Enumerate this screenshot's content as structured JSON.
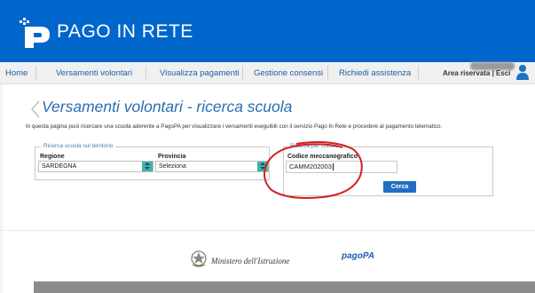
{
  "app": {
    "logo_text": "PAGO IN RETE"
  },
  "nav": {
    "items": [
      "Home",
      "Versamenti volontari",
      "Visualizza pagamenti",
      "Gestione consensi",
      "Richiedi assistenza"
    ],
    "area_riservata": "Area riservata | Esci"
  },
  "page": {
    "title": "Versamenti volontari - ricerca scuola",
    "intro": "In questa pagina puoi ricercare una scuola aderente a PagoPA per visualizzare i versamenti eseguibili con il servizio Pago In Rete e procedere al pagamento telematico."
  },
  "territorio": {
    "legend": "Ricerca scuola sul territorio",
    "regione_label": "Regione",
    "regione_value": "SARDEGNA",
    "provincia_label": "Provincia",
    "provincia_value": "Seleziona"
  },
  "codice": {
    "legend": "Ricerca per codice",
    "label": "Codice meccanografico",
    "value": "CAMM202003",
    "button": "Cerca"
  },
  "footer": {
    "ministero": "Ministero dell'Istruzione",
    "pagopa": "pagoPA"
  },
  "colors": {
    "header": "#0066cc",
    "link": "#1a5fa8",
    "title": "#2a6db5",
    "annotation": "#d22020",
    "button": "#1f6fc3"
  }
}
